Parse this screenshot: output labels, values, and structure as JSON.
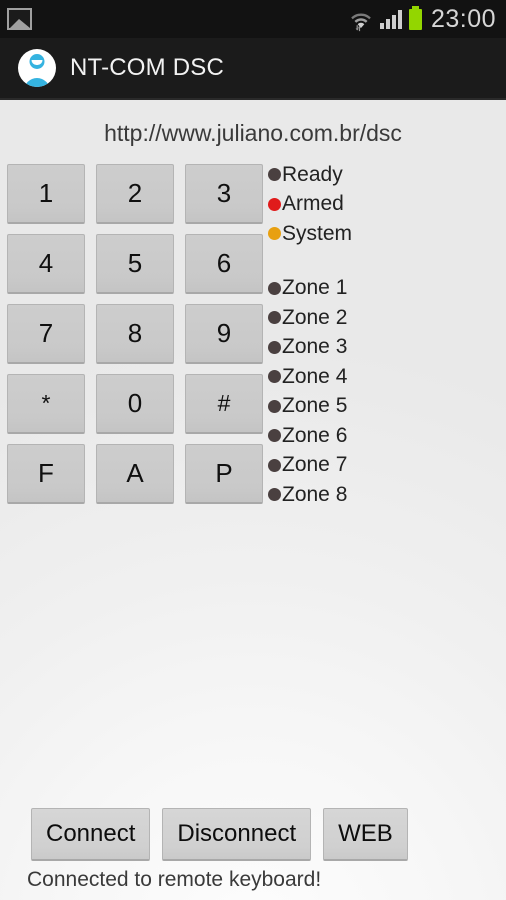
{
  "statusbar": {
    "notification_icon": "photo-image-icon",
    "wifi_icon": "wifi-data-transfer-icon",
    "signal_icon": "cellular-signal-icon",
    "battery_icon": "battery-full-icon",
    "battery_color": "#93d600",
    "clock": "23:00"
  },
  "actionbar": {
    "avatar_icon": "user-avatar-icon",
    "avatar_color": "#35b3e0",
    "title": "NT-COM DSC"
  },
  "main": {
    "url": "http://www.juliano.com.br/dsc",
    "keypad": {
      "rows": [
        [
          {
            "label": "1",
            "type": "digit"
          },
          {
            "label": "2",
            "type": "digit"
          },
          {
            "label": "3",
            "type": "digit"
          }
        ],
        [
          {
            "label": "4",
            "type": "digit"
          },
          {
            "label": "5",
            "type": "digit"
          },
          {
            "label": "6",
            "type": "digit"
          }
        ],
        [
          {
            "label": "7",
            "type": "digit"
          },
          {
            "label": "8",
            "type": "digit"
          },
          {
            "label": "9",
            "type": "digit"
          }
        ],
        [
          {
            "label": "*",
            "type": "symbol"
          },
          {
            "label": "0",
            "type": "digit"
          },
          {
            "label": "#",
            "type": "symbol"
          }
        ],
        [
          {
            "label": "F",
            "type": "letter"
          },
          {
            "label": "A",
            "type": "letter"
          },
          {
            "label": "P",
            "type": "letter"
          }
        ]
      ]
    },
    "status_indicators": [
      {
        "label": "Ready",
        "state": "off",
        "color": "#4a4040"
      },
      {
        "label": "Armed",
        "state": "on",
        "color": "#e01b1b"
      },
      {
        "label": "System",
        "state": "on",
        "color": "#e8a010"
      }
    ],
    "zone_indicators": [
      {
        "label": "Zone 1",
        "state": "off",
        "color": "#4a4040"
      },
      {
        "label": "Zone 2",
        "state": "off",
        "color": "#4a4040"
      },
      {
        "label": "Zone 3",
        "state": "off",
        "color": "#4a4040"
      },
      {
        "label": "Zone 4",
        "state": "off",
        "color": "#4a4040"
      },
      {
        "label": "Zone 5",
        "state": "off",
        "color": "#4a4040"
      },
      {
        "label": "Zone 6",
        "state": "off",
        "color": "#4a4040"
      },
      {
        "label": "Zone 7",
        "state": "off",
        "color": "#4a4040"
      },
      {
        "label": "Zone 8",
        "state": "off",
        "color": "#4a4040"
      }
    ]
  },
  "footer": {
    "buttons": [
      {
        "label": "Connect",
        "name": "connect-button"
      },
      {
        "label": "Disconnect",
        "name": "disconnect-button"
      },
      {
        "label": "WEB",
        "name": "web-button"
      }
    ],
    "status_message": "Connected to remote keyboard!"
  }
}
